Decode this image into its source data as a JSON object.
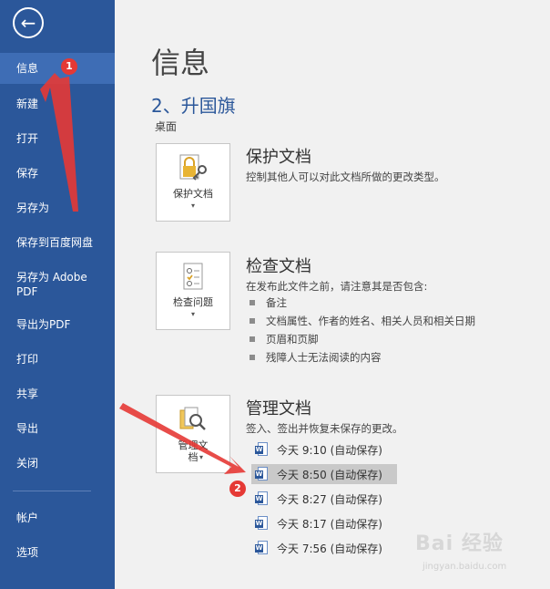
{
  "sidebar": {
    "items": [
      {
        "label": "信息"
      },
      {
        "label": "新建"
      },
      {
        "label": "打开"
      },
      {
        "label": "保存"
      },
      {
        "label": "另存为"
      },
      {
        "label": "保存到百度网盘"
      },
      {
        "label": "另存为 Adobe PDF"
      },
      {
        "label": "导出为PDF"
      },
      {
        "label": "打印"
      },
      {
        "label": "共享"
      },
      {
        "label": "导出"
      },
      {
        "label": "关闭"
      },
      {
        "label": "帐户"
      },
      {
        "label": "选项"
      }
    ]
  },
  "main": {
    "title": "信息",
    "doc_name": "2、升国旗",
    "doc_path": "桌面",
    "protect": {
      "button_label": "保护文档",
      "title": "保护文档",
      "desc": "控制其他人可以对此文档所做的更改类型。"
    },
    "inspect": {
      "button_label": "检查问题",
      "title": "检查文档",
      "desc": "在发布此文件之前，请注意其是否包含:",
      "bullets": [
        "备注",
        "文档属性、作者的姓名、相关人员和相关日期",
        "页眉和页脚",
        "残障人士无法阅读的内容"
      ]
    },
    "manage": {
      "button_label_1": "管理文",
      "button_label_2": "档",
      "title": "管理文档",
      "desc": "签入、签出并恢复未保存的更改。",
      "versions": [
        "今天 9:10 (自动保存)",
        "今天 8:50 (自动保存)",
        "今天 8:27 (自动保存)",
        "今天 8:17 (自动保存)",
        "今天 7:56 (自动保存)"
      ]
    }
  },
  "annotations": {
    "badge1": "1",
    "badge2": "2"
  },
  "watermark": {
    "main": "Bai 经验",
    "sub": "jingyan.baidu.com"
  },
  "colors": {
    "sidebar": "#2b579a",
    "accent_red": "#e53935"
  }
}
